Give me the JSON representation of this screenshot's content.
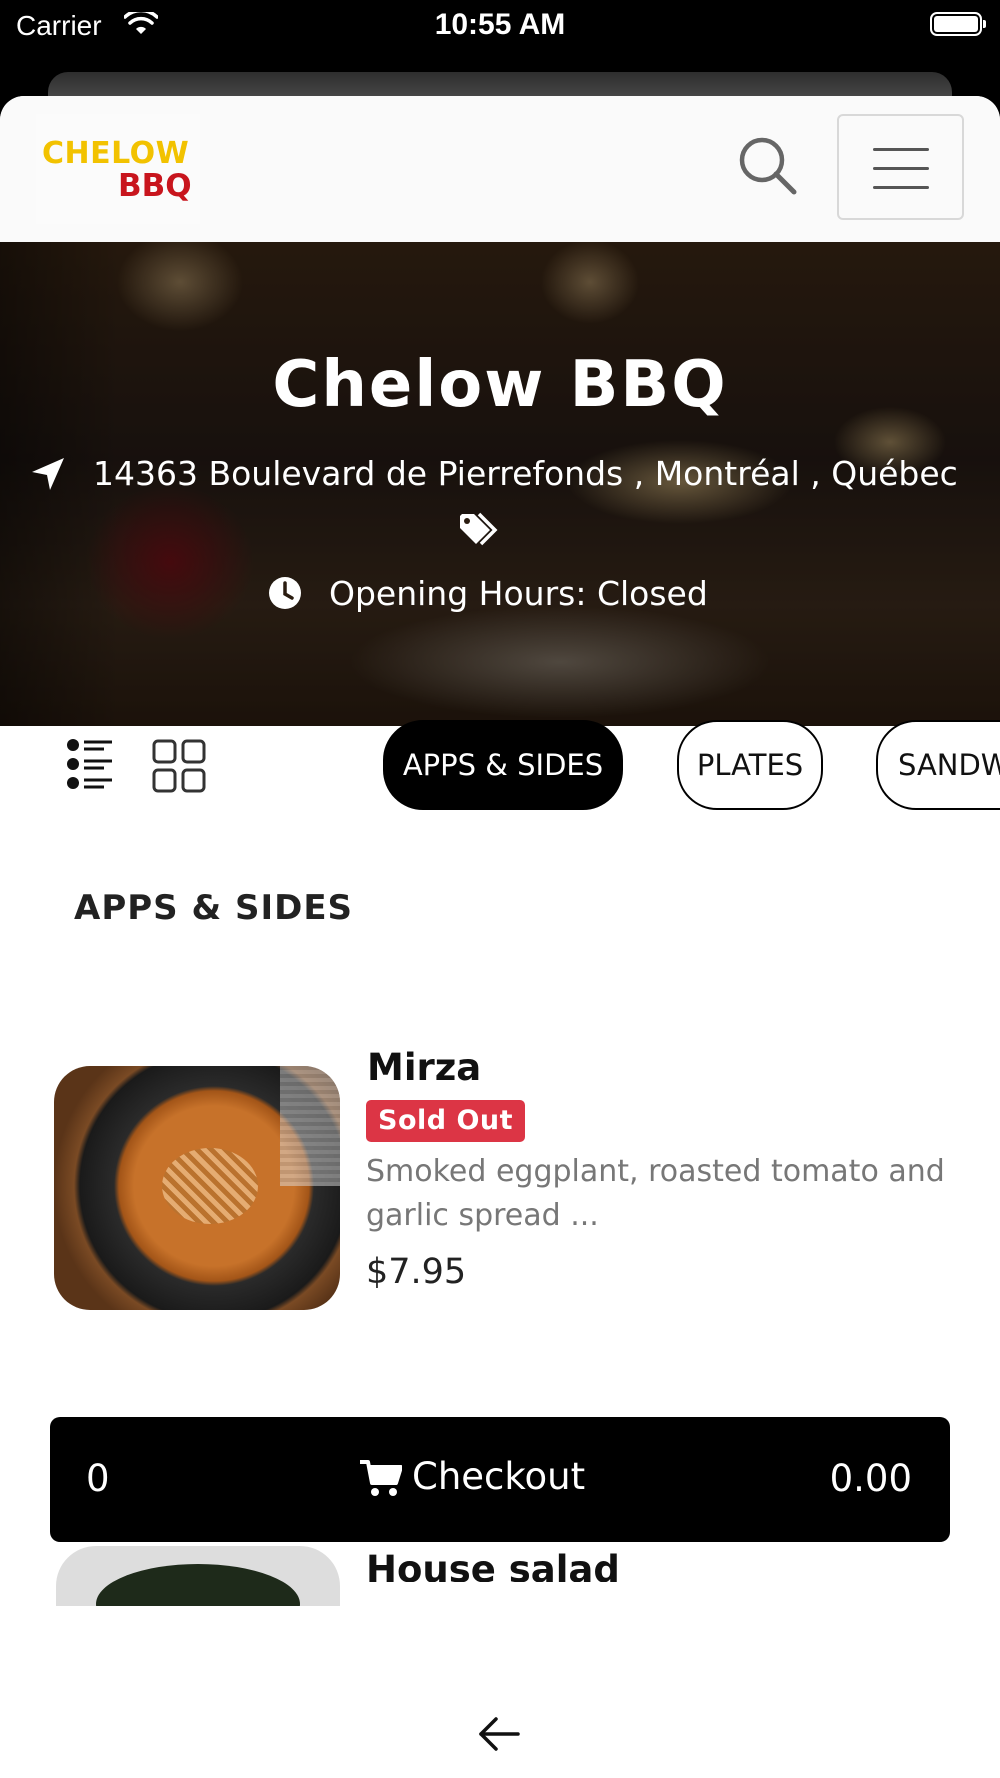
{
  "status_bar": {
    "carrier": "Carrier",
    "time": "10:55 AM"
  },
  "header": {
    "logo_line1": "CHELOW",
    "logo_line2": "BBQ"
  },
  "hero": {
    "title": "Chelow BBQ",
    "address": "14363 Boulevard de Pierrefonds , Montréal , Québec",
    "hours": "Opening Hours: Closed"
  },
  "categories": [
    "APPS & SIDES",
    "PLATES",
    "SANDW"
  ],
  "section": {
    "title": "APPS & SIDES"
  },
  "items": [
    {
      "name": "Mirza",
      "badge": "Sold Out",
      "description": "Smoked eggplant, roasted tomato and garlic spread ...",
      "price": "$7.95"
    },
    {
      "name": "House salad"
    }
  ],
  "checkout": {
    "count": "0",
    "label": "Checkout",
    "total": "0.00"
  },
  "colors": {
    "accent": "#000000",
    "sold_out": "#dc3545",
    "logo_yellow": "#f2c200",
    "logo_red": "#c8151d"
  }
}
